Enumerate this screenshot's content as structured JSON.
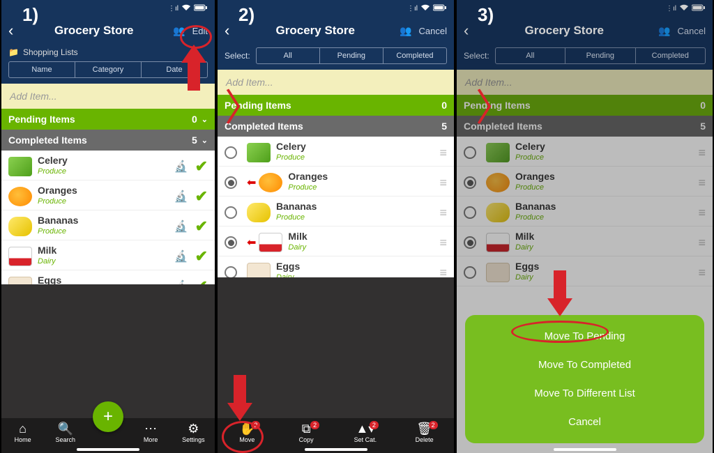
{
  "screens": {
    "s1": {
      "step_label": "1)",
      "title": "Grocery Store",
      "action_link": "Edit",
      "folder_label": "Shopping Lists",
      "sort_tabs": {
        "name": "Name",
        "category": "Category",
        "date": "Date"
      },
      "add_item_placeholder": "Add Item...",
      "pending_label": "Pending Items",
      "pending_count": "0",
      "completed_label": "Completed Items",
      "completed_count": "5",
      "tabbar": {
        "home": "Home",
        "search": "Search",
        "more": "More",
        "settings": "Settings"
      }
    },
    "s2": {
      "step_label": "2)",
      "title": "Grocery Store",
      "action_link": "Cancel",
      "select_label": "Select:",
      "select_tabs": {
        "all": "All",
        "pending": "Pending",
        "completed": "Completed"
      },
      "add_item_placeholder": "Add Item...",
      "pending_label": "Pending Items",
      "pending_count": "0",
      "completed_label": "Completed Items",
      "completed_count": "5",
      "tabbar": {
        "move": "Move",
        "copy": "Copy",
        "setcat": "Set Cat.",
        "delete": "Delete",
        "badge": "2"
      }
    },
    "s3": {
      "step_label": "3)",
      "title": "Grocery Store",
      "action_link": "Cancel",
      "select_label": "Select:",
      "select_tabs": {
        "all": "All",
        "pending": "Pending",
        "completed": "Completed"
      },
      "add_item_placeholder": "Add Item...",
      "pending_label": "Pending Items",
      "pending_count": "0",
      "completed_label": "Completed Items",
      "completed_count": "5",
      "sheet": {
        "opt1": "Move To Pending",
        "opt2": "Move To Completed",
        "opt3": "Move To Different List",
        "opt4": "Cancel"
      }
    }
  },
  "items": [
    {
      "name": "Celery",
      "category": "Produce",
      "thumb": "celery"
    },
    {
      "name": "Oranges",
      "category": "Produce",
      "thumb": "oranges"
    },
    {
      "name": "Bananas",
      "category": "Produce",
      "thumb": "bananas"
    },
    {
      "name": "Milk",
      "category": "Dairy",
      "thumb": "milk"
    },
    {
      "name": "Eggs",
      "category": "Dairy",
      "thumb": "eggs"
    }
  ],
  "selected_indices": [
    1,
    3
  ]
}
